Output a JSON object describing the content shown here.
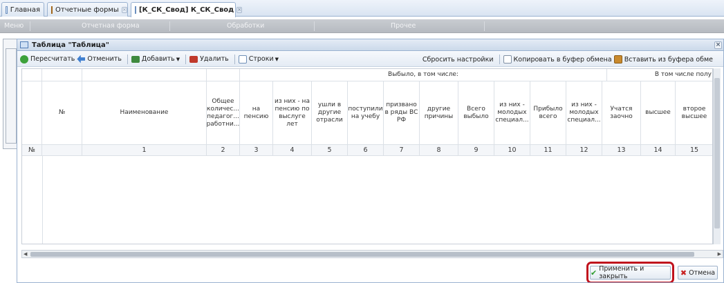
{
  "tabs": [
    {
      "label": "Главная"
    },
    {
      "label": "Отчетные формы"
    },
    {
      "label": "[К_СК_Свод] К_СК_Свод"
    }
  ],
  "menu": [
    "Меню",
    "Отчетная форма",
    "Обработки",
    "Прочее"
  ],
  "dialog": {
    "title": "Таблица \"Таблица\"",
    "close": "×"
  },
  "toolbar": {
    "recalc": "Пересчитать",
    "undo": "Отменить",
    "add": "Добавить",
    "delete": "Удалить",
    "rows": "Строки",
    "reset": "Сбросить настройки",
    "copy": "Копировать в буфер обмена",
    "paste": "Вставить из буфера обме"
  },
  "grid": {
    "group_left": "Выбыло, в том числе:",
    "group_right": "В том числе полу",
    "columns": [
      "№",
      "Наименование",
      "Общее количес... педагог... работни...",
      "на пенсию",
      "из них - на пенсию по выслуге лет",
      "ушли в другие отрасли",
      "поступили на учебу",
      "призвано в ряды ВС РФ",
      "другие причины",
      "Всего выбыло",
      "из них - молодых специал...",
      "Прибыло всего",
      "из них - молодых специал...",
      "Учатся заочно",
      "высшее",
      "второе высшее"
    ],
    "numbers": [
      "№",
      "1",
      "2",
      "3",
      "4",
      "5",
      "6",
      "7",
      "8",
      "9",
      "10",
      "11",
      "12",
      "13",
      "14",
      "15"
    ]
  },
  "buttons": {
    "apply": "Применить и закрыть",
    "cancel": "Отмена"
  },
  "colors": {
    "highlight": "#c0121d",
    "accent": "#99b1d0"
  }
}
